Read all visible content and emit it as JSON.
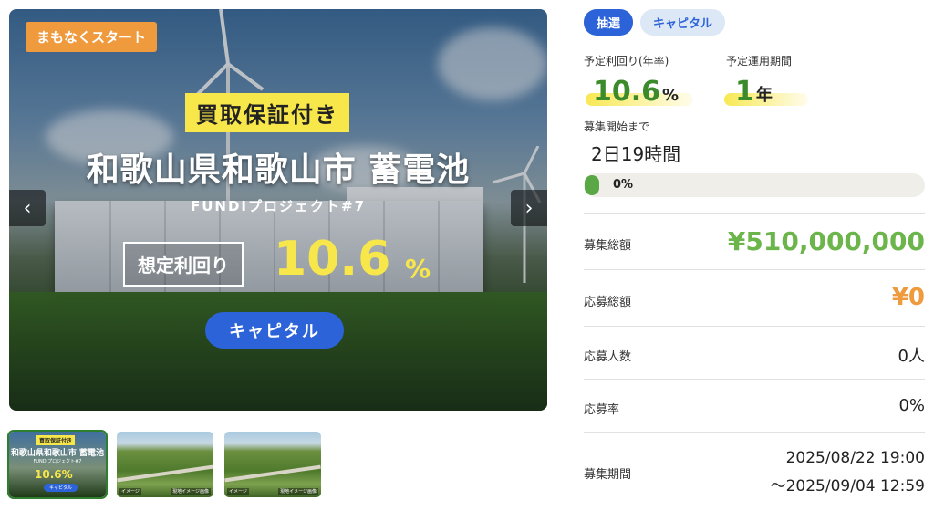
{
  "hero": {
    "badge": "まもなくスタート",
    "guarantee": "買取保証付き",
    "title": "和歌山県和歌山市 蓄電池",
    "subtitle": "FUNDIプロジェクト#7",
    "yield_label": "想定利回り",
    "yield_value": "10.6",
    "yield_unit": "%",
    "category_pill": "キャピタル",
    "prev_icon": "chevron-left-icon",
    "next_icon": "chevron-right-icon"
  },
  "thumbnails": [
    {
      "guarantee": "買取保証付き",
      "title": "和歌山県和歌山市 蓄電池",
      "subtitle": "FUNDIプロジェクト#7",
      "yield": "10.6%",
      "pill": "キャピタル",
      "active": true
    },
    {
      "caption_left": "イメージ",
      "caption_right": "現地イメージ画像",
      "active": false
    },
    {
      "caption_left": "イメージ",
      "caption_right": "現地イメージ画像",
      "active": false
    }
  ],
  "tags": [
    "抽選",
    "キャピタル"
  ],
  "stats": {
    "yield_label": "予定利回り(年率)",
    "yield_value": "10.6",
    "yield_unit": "%",
    "term_label": "予定運用期間",
    "term_value": "1",
    "term_unit": "年",
    "countdown_label": "募集開始まで",
    "countdown_value": "2日19時間",
    "progress_text": "0%",
    "progress_fraction": 0.0
  },
  "details": [
    {
      "label": "募集総額",
      "value": "¥510,000,000"
    },
    {
      "label": "応募総額",
      "value": "¥0"
    },
    {
      "label": "応募人数",
      "value": "0人"
    },
    {
      "label": "応募率",
      "value": "0%"
    },
    {
      "label": "募集期間",
      "value_line1": "2025/08/22 19:00",
      "value_line2": "～2025/09/04 12:59"
    }
  ],
  "colors": {
    "accent_blue": "#2d63d8",
    "green": "#5aa845",
    "orange": "#ee9a3d",
    "yellow": "#f8e74a"
  }
}
